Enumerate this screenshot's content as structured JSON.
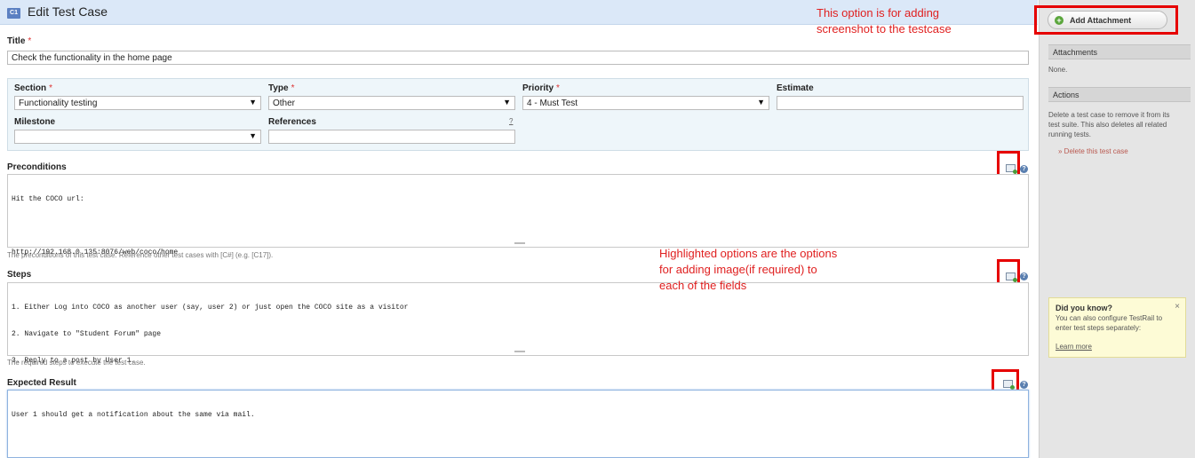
{
  "header": {
    "badge": "C1",
    "title": "Edit Test Case"
  },
  "form": {
    "title_label": "Title",
    "required_mark": "*",
    "title_value": "Check the functionality in the home page",
    "section": {
      "label": "Section",
      "value": "Functionality testing"
    },
    "type": {
      "label": "Type",
      "value": "Other"
    },
    "priority": {
      "label": "Priority",
      "value": "4 - Must Test"
    },
    "estimate": {
      "label": "Estimate",
      "value": ""
    },
    "milestone": {
      "label": "Milestone",
      "value": ""
    },
    "references": {
      "label": "References",
      "value": "",
      "help": "?"
    },
    "select_arrow": "▼",
    "preconditions": {
      "label": "Preconditions",
      "line1": "Hit the COCO url:",
      "line2": "",
      "line3": "http://192.168.0.135:8076/web/coco/home",
      "hint": "The preconditions of this test case. Reference other test cases with [C#] (e.g. [C17])."
    },
    "steps": {
      "label": "Steps",
      "line1": "1. Either Log into COCO as another user (say, user 2) or just open the COCO site as a visitor",
      "line2": "2. Navigate to \"Student Forum\" page",
      "line3": "3. Reply to a post by User 1.",
      "hint": "The required steps to execute the test case."
    },
    "expected": {
      "label": "Expected Result",
      "line1": "User 1 should get a notification about the same via mail."
    },
    "help_glyph": "?"
  },
  "annotations": {
    "top_line1": "This option is for adding",
    "top_line2": "screenshot to the testcase",
    "mid_line1": "Highlighted options are the options",
    "mid_line2": "for adding image(if required) to",
    "mid_line3": "each of the fields",
    "color": "#e02020"
  },
  "sidebar": {
    "add_attachment": "Add Attachment",
    "add_icon": "+",
    "attachments_header": "Attachments",
    "attachments_text": "None.",
    "actions_header": "Actions",
    "actions_line1": "Delete a test case to remove it from its",
    "actions_line2": "test suite. This also deletes all related",
    "actions_line3": "running tests.",
    "delete_link": "» Delete this test case",
    "tip": {
      "title": "Did you know?",
      "close": "×",
      "line1": "You can also configure TestRail to",
      "line2": "enter test steps separately:",
      "link": "Learn more"
    }
  },
  "colors": {
    "header_bg": "#dbe8f8",
    "highlight": "#e60000",
    "panel_bg": "#eef6fa",
    "sidebar_bg": "#e5e5e5"
  }
}
